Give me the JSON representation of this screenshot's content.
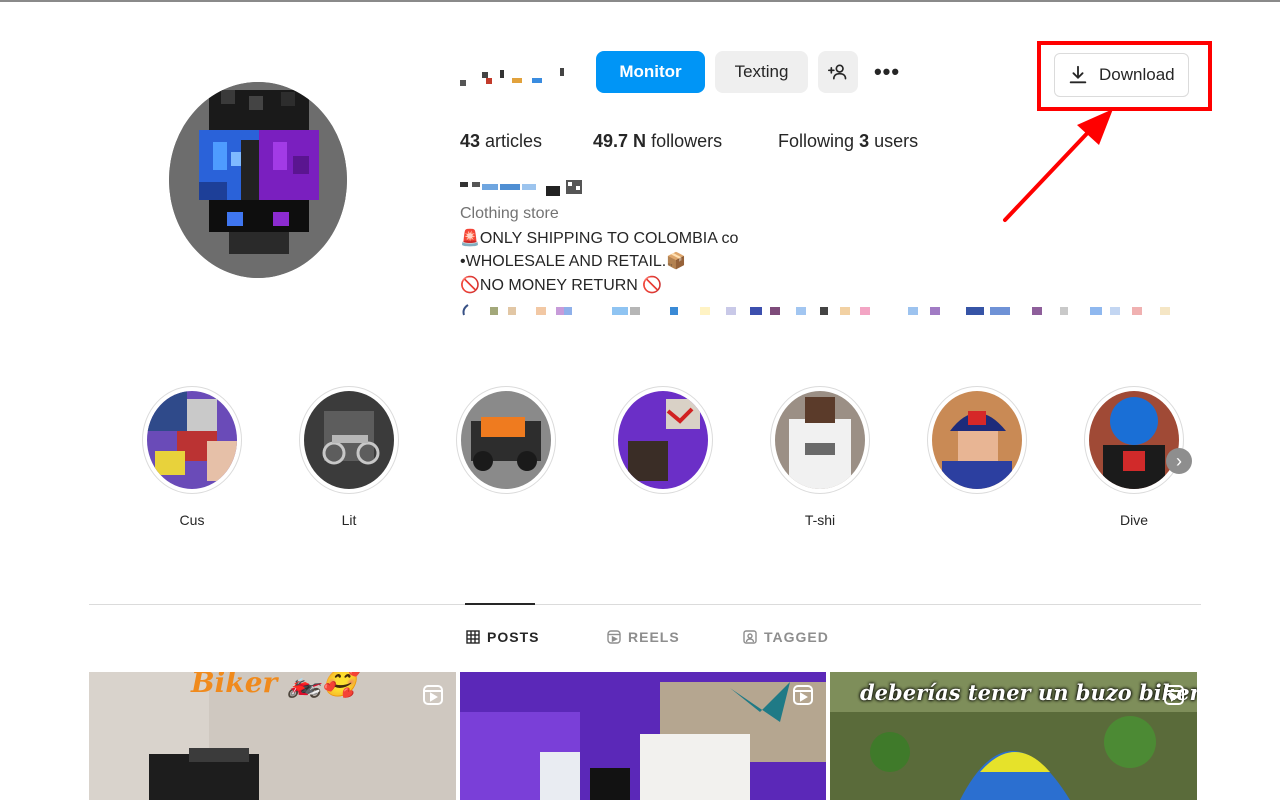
{
  "header": {
    "monitor_label": "Monitor",
    "texting_label": "Texting",
    "more_label": "•••"
  },
  "stats": {
    "articles_count": "43",
    "articles_label": "articles",
    "followers_count": "49.7 N",
    "followers_label": "followers",
    "following_prefix": "Following",
    "following_count": "3",
    "following_suffix": "users"
  },
  "bio": {
    "category": "Clothing store",
    "line1": "🚨ONLY SHIPPING TO COLOMBIA co",
    "line2": "•WHOLESALE AND RETAIL.📦",
    "line3": "🚫NO MONEY RETURN 🚫"
  },
  "download": {
    "label": "Download",
    "highlight_color": "#ff0000"
  },
  "highlights": [
    {
      "label": "Cus"
    },
    {
      "label": "Lit"
    },
    {
      "label": ""
    },
    {
      "label": ""
    },
    {
      "label": "T-shi"
    },
    {
      "label": ""
    },
    {
      "label": "Dive"
    }
  ],
  "tabs": [
    {
      "label": "POSTS",
      "icon": "grid-icon",
      "active": true
    },
    {
      "label": "REELS",
      "icon": "reels-icon",
      "active": false
    },
    {
      "label": "TAGGED",
      "icon": "tagged-icon",
      "active": false
    }
  ],
  "posts": [
    {
      "caption": "Biker 🏍️🥰"
    },
    {
      "caption": ""
    },
    {
      "caption": "deberías tener un buzo biker"
    }
  ],
  "colors": {
    "primary_button": "#0095f6",
    "secondary_button": "#efefef",
    "text": "#262626",
    "muted": "#737373"
  }
}
